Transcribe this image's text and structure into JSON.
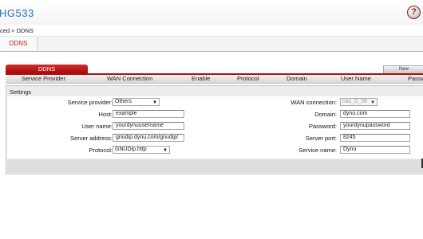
{
  "header": {
    "brand": "HG533",
    "help_icon": "?"
  },
  "breadcrumb": "ced > DDNS",
  "top_tab": "DDNS",
  "panel": {
    "tab_label": "DDNS",
    "new_button": "New"
  },
  "table": {
    "columns": [
      "Service Provider",
      "WAN Connection",
      "Enable",
      "Protocol",
      "Domain",
      "User Name",
      "Passw"
    ]
  },
  "settings": {
    "title": "Settings",
    "service_provider": {
      "label": "Service provider:",
      "value": "Others"
    },
    "host": {
      "label": "Host:",
      "value": "example"
    },
    "user_name": {
      "label": "User name:",
      "value": "yourdynuusername"
    },
    "server_address": {
      "label": "Server address:",
      "value": "gnudip.dynu.com/gnudip/"
    },
    "protocol": {
      "label": "Protocol:",
      "value": "GNUDip.http"
    },
    "wan_connection": {
      "label": "WAN connection:",
      "value": "nas_0_38"
    },
    "domain": {
      "label": "Domain:",
      "value": "dynu.com"
    },
    "password": {
      "label": "Password:",
      "value": "yourdynupassword"
    },
    "server_port": {
      "label": "Server port:",
      "value": "8245"
    },
    "service_name": {
      "label": "Service name:",
      "value": "Dynu"
    }
  },
  "colors": {
    "accent_red": "#b10f0f",
    "brand_blue": "#1d74c4"
  }
}
